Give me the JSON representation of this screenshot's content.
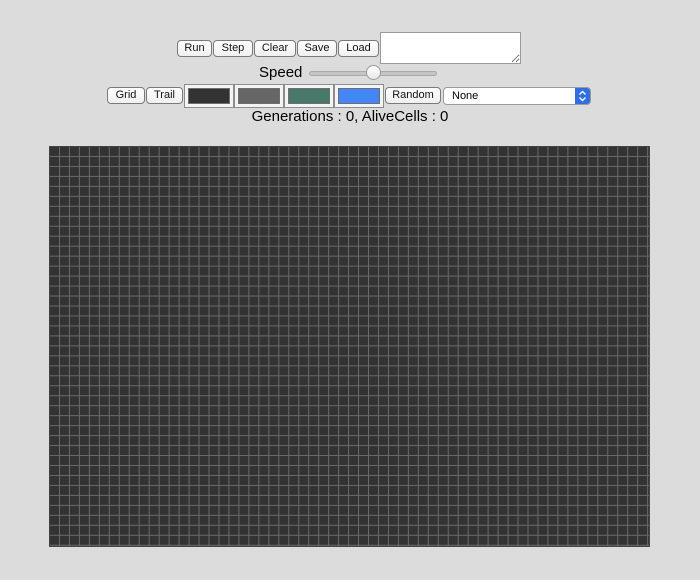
{
  "toolbar": {
    "run_label": "Run",
    "step_label": "Step",
    "clear_label": "Clear",
    "save_label": "Save",
    "load_label": "Load",
    "save_text": ""
  },
  "speed": {
    "label": "Speed",
    "value_fraction": 0.5
  },
  "options": {
    "grid_label": "Grid",
    "trail_label": "Trail",
    "random_label": "Random",
    "colors": [
      {
        "name": "dead-cell-color",
        "hex": "#333333"
      },
      {
        "name": "grid-color",
        "hex": "#666666"
      },
      {
        "name": "trail-color",
        "hex": "#48786a"
      },
      {
        "name": "alive-cell-color",
        "hex": "#4287f5"
      }
    ],
    "pattern_selected": "None"
  },
  "status": {
    "generations_label": "Generations : ",
    "generations_value": "0",
    "separator": ", ",
    "alive_label": "AliveCells : ",
    "alive_value": "0"
  },
  "board": {
    "columns": 60,
    "rows": 40,
    "background_color": "#333333",
    "line_color": "#6a6a6a"
  }
}
